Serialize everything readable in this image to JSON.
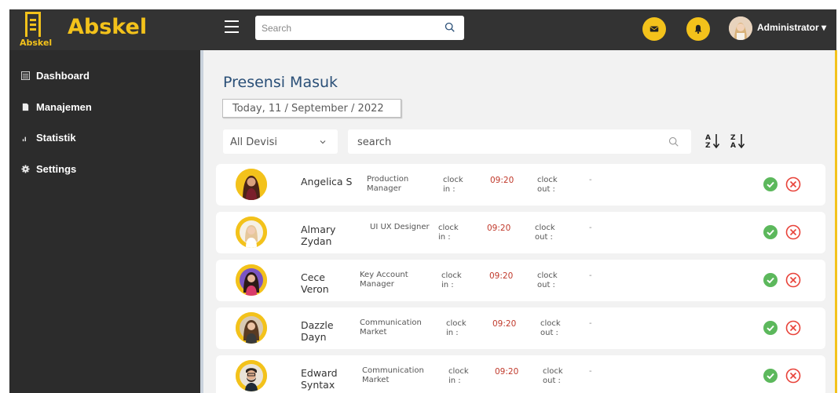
{
  "brand": {
    "name": "Abskel",
    "logo_text": "Abskel"
  },
  "topbar": {
    "search_placeholder": "Search",
    "user_name": "Administrator",
    "user_caret": "▾",
    "accent_color": "#f3c21b"
  },
  "sidebar": {
    "items": [
      {
        "label": "Dashboard",
        "icon": "dashboard-icon"
      },
      {
        "label": "Manajemen",
        "icon": "folder-icon"
      },
      {
        "label": "Statistik",
        "icon": "bar-chart-icon"
      },
      {
        "label": "Settings",
        "icon": "gear-icon"
      }
    ]
  },
  "main": {
    "title": "Presensi Masuk",
    "date": "Today, 11 / September / 2022",
    "filter": {
      "selected": "All Devisi"
    },
    "search": {
      "placeholder": "search"
    }
  },
  "rows": [
    {
      "name": "Angelica S",
      "position": "Production Manager",
      "clock_in_label": "clock in :",
      "clock_in": "09:20",
      "clock_out_label": "clock out :",
      "clock_out": "-"
    },
    {
      "name": "Almary Zydan",
      "position": "UI UX Designer",
      "clock_in_label": "clock in :",
      "clock_in": "09:20",
      "clock_out_label": "clock out :",
      "clock_out": "-"
    },
    {
      "name": "Cece Veron",
      "position": "Key Account Manager",
      "clock_in_label": "clock in :",
      "clock_in": "09:20",
      "clock_out_label": "clock out :",
      "clock_out": "-"
    },
    {
      "name": "Dazzle Dayn",
      "position": "Communication Market",
      "clock_in_label": "clock in :",
      "clock_in": "09:20",
      "clock_out_label": "clock out :",
      "clock_out": "-"
    },
    {
      "name": "Edward Syntax",
      "position": "Communication Market",
      "clock_in_label": "clock in :",
      "clock_in": "09:20",
      "clock_out_label": "clock out :",
      "clock_out": "-"
    }
  ]
}
